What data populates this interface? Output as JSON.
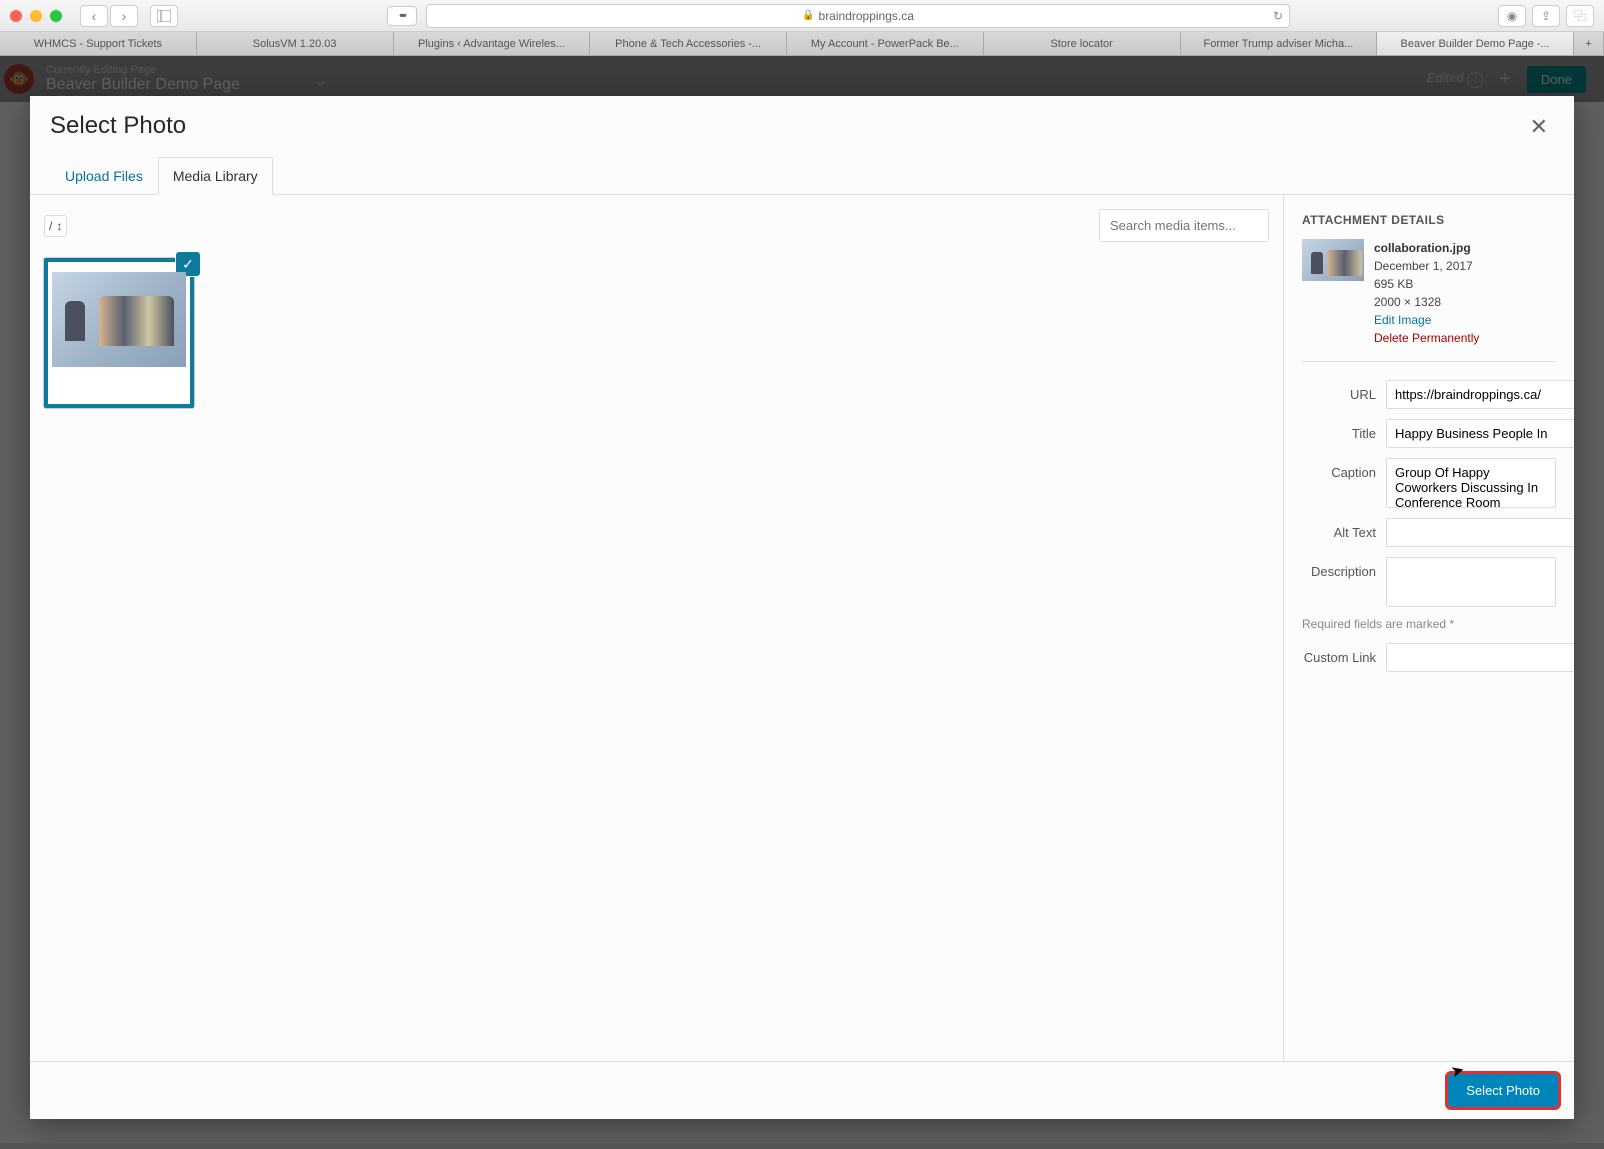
{
  "browser": {
    "url": "braindroppings.ca",
    "tabs": [
      "WHMCS - Support Tickets",
      "SolusVM 1.20.03",
      "Plugins ‹ Advantage Wireles...",
      "Phone & Tech Accessories -...",
      "My Account - PowerPack Be...",
      "Store locator",
      "Former Trump adviser Micha...",
      "Beaver Builder Demo Page -..."
    ],
    "reader_btn": "•••"
  },
  "editor": {
    "subtitle": "Currently Editing Page",
    "title": "Beaver Builder Demo Page",
    "edited": "Edited",
    "done": "Done"
  },
  "modal": {
    "title": "Select Photo",
    "tab_upload": "Upload Files",
    "tab_media": "Media Library",
    "date_filter": "/",
    "search_placeholder": "Search media items...",
    "footer_btn": "Select Photo"
  },
  "details": {
    "heading": "ATTACHMENT DETAILS",
    "filename": "collaboration.jpg",
    "date": "December 1, 2017",
    "size": "695 KB",
    "dimensions": "2000 × 1328",
    "edit_image": "Edit Image",
    "delete": "Delete Permanently",
    "labels": {
      "url": "URL",
      "title": "Title",
      "caption": "Caption",
      "alt": "Alt Text",
      "description": "Description",
      "custom_link": "Custom Link"
    },
    "values": {
      "url": "https://braindroppings.ca/",
      "title": "Happy Business People In",
      "caption": "Group Of Happy Coworkers Discussing In Conference Room",
      "alt": "",
      "description": "",
      "custom_link": ""
    },
    "required_note": "Required fields are marked *"
  }
}
